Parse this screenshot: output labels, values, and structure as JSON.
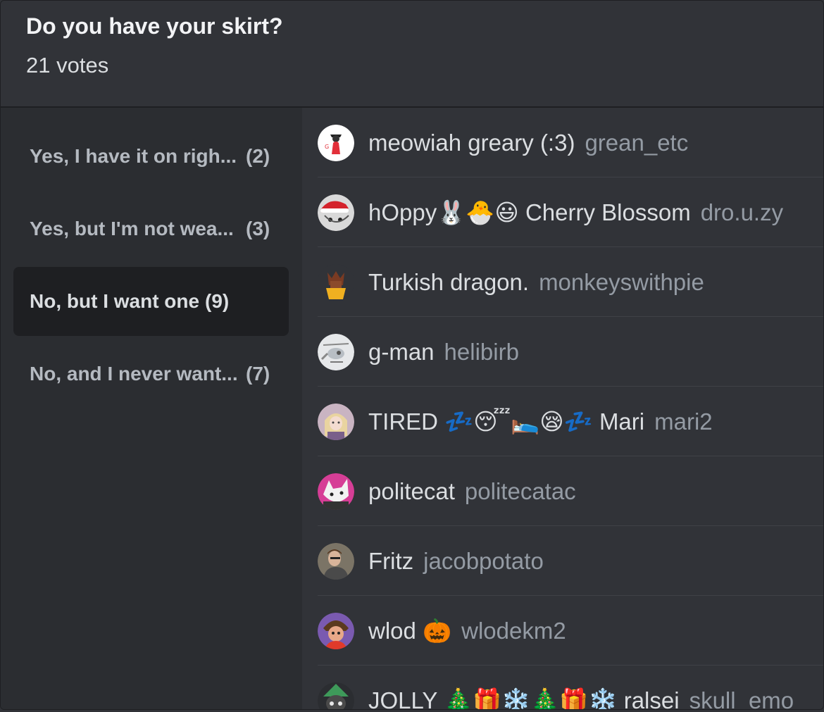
{
  "poll": {
    "question": "Do you have your skirt?",
    "votes": "21 votes"
  },
  "options": [
    {
      "label": "Yes, I have it on righ...",
      "count": "(2)"
    },
    {
      "label": "Yes, but I'm not wea...",
      "count": "(3)"
    },
    {
      "label": "No, but I want one",
      "count": "(9)"
    },
    {
      "label": "No, and I never want...",
      "count": "(7)"
    }
  ],
  "voters": [
    {
      "display": "meowiah greary (:3)",
      "username": "grean_etc",
      "avatar_icon": "red-cat-avatar"
    },
    {
      "display": "hOppy🐰🐣😃 Cherry Blossom",
      "username": "dro.u.zy",
      "avatar_icon": "santa-hat-avatar"
    },
    {
      "display": "Turkish dragon.",
      "username": "monkeyswithpie",
      "avatar_icon": "dragon-avatar"
    },
    {
      "display": "g-man",
      "username": "helibirb",
      "avatar_icon": "helicopter-avatar"
    },
    {
      "display": "TIRED 💤😴🛌😪💤 Mari",
      "username": "mari2",
      "avatar_icon": "anime-girl-avatar"
    },
    {
      "display": "politecat",
      "username": "politecatac",
      "avatar_icon": "pink-cat-avatar"
    },
    {
      "display": "Fritz",
      "username": "jacobpotato",
      "avatar_icon": "photo-avatar"
    },
    {
      "display": "wlod 🎃",
      "username": "wlodekm2",
      "avatar_icon": "cartoon-avatar"
    },
    {
      "display": "JOLLY 🎄🎁❄️🎄🎁❄️ ralsei",
      "username": "skull_emo",
      "avatar_icon": "ralsei-avatar"
    }
  ],
  "colors": {
    "background": "#313338",
    "sidebar": "#2b2d31",
    "selected": "#1e1f22",
    "text_primary": "#dbdee1",
    "text_muted": "#949ba4"
  }
}
